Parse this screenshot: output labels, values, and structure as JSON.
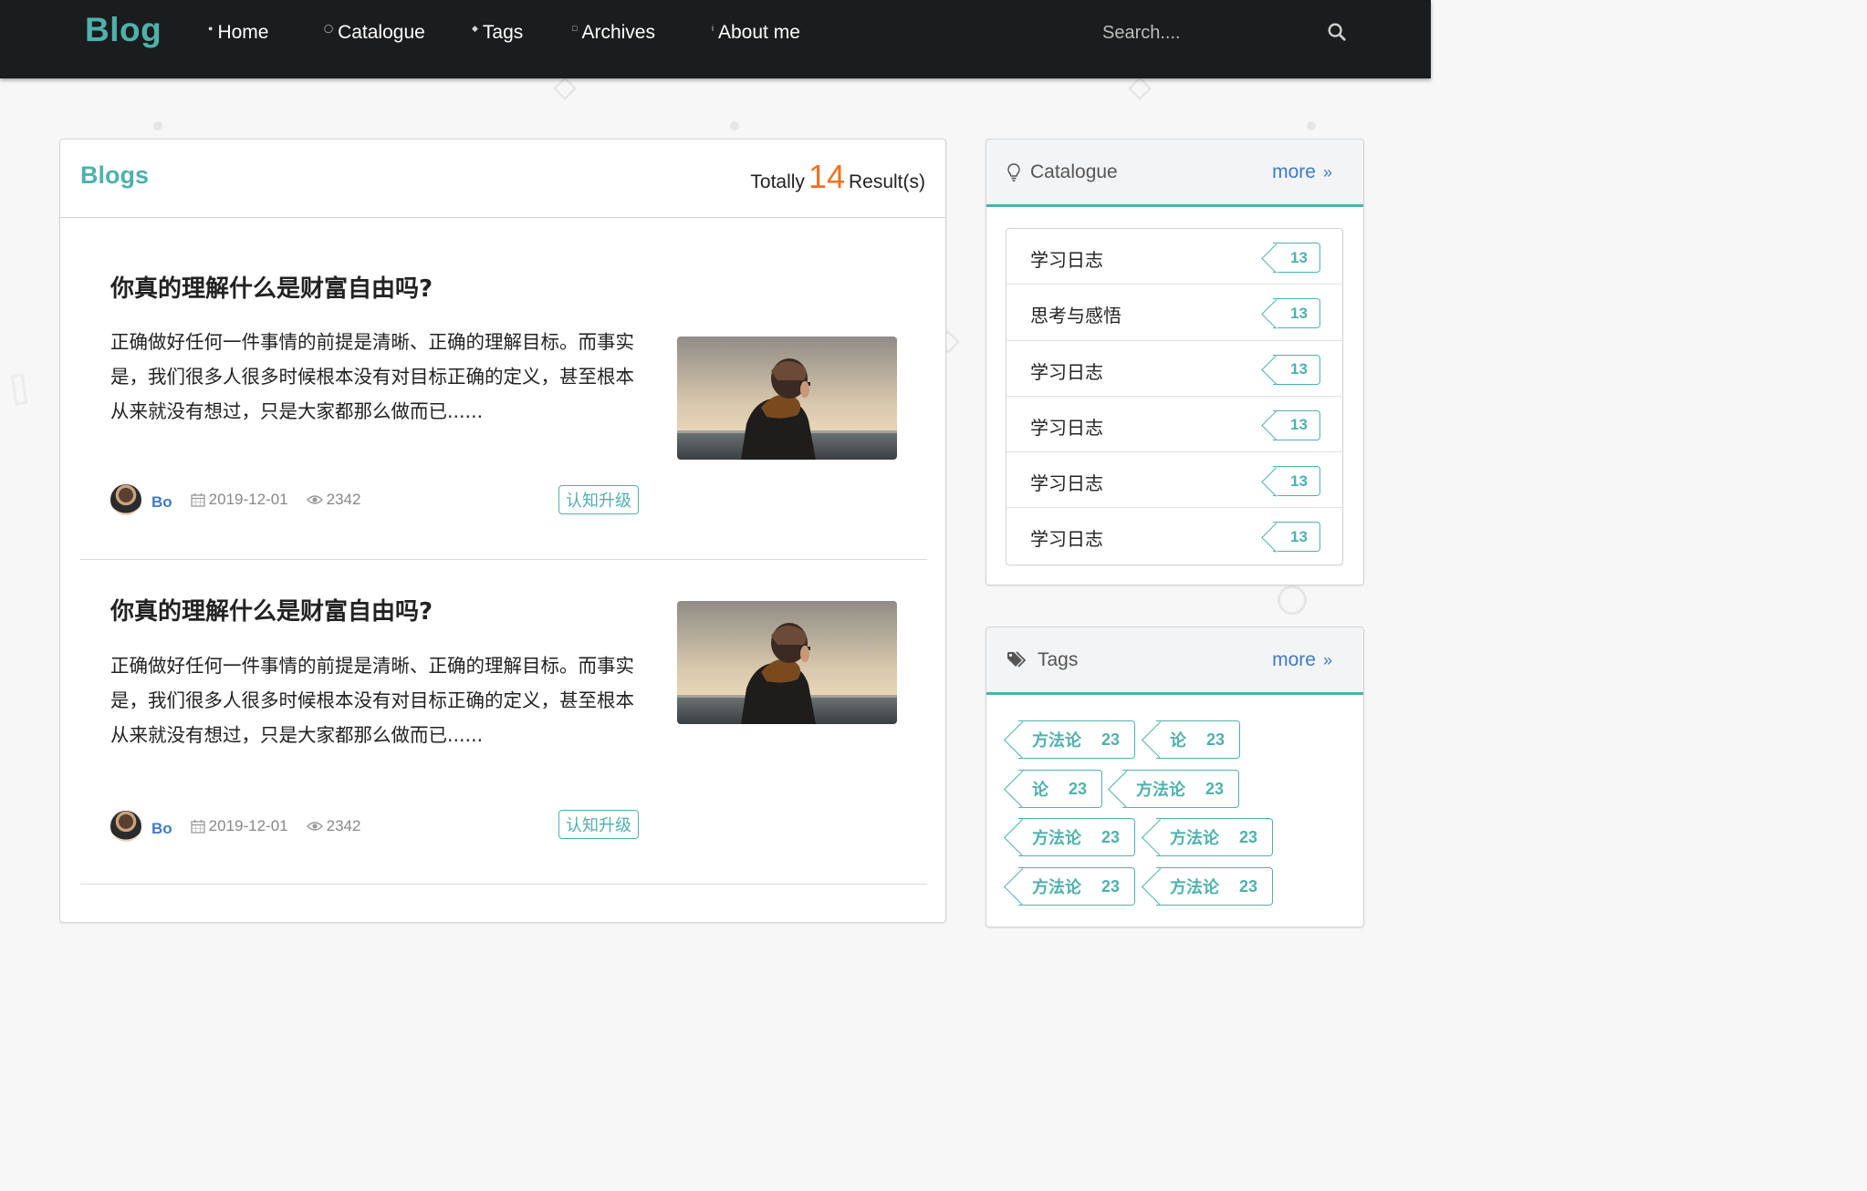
{
  "nav": {
    "brand": "Blog",
    "items": [
      {
        "label": "Home",
        "icon": "home-icon"
      },
      {
        "label": "Catalogue",
        "icon": "idea-icon"
      },
      {
        "label": "Tags",
        "icon": "tag-icon"
      },
      {
        "label": "Archives",
        "icon": "clone-icon"
      },
      {
        "label": "About me",
        "icon": "info-icon"
      }
    ],
    "search_placeholder": "Search....",
    "search_icon": "search-icon"
  },
  "main": {
    "title": "Blogs",
    "total_prefix": "Totally",
    "total_count": "14",
    "total_suffix": "Result(s)",
    "posts": [
      {
        "title": "你真的理解什么是财富自由吗?",
        "excerpt": "正确做好任何一件事情的前提是清晰、正确的理解目标。而事实是，我们很多人很多时候根本没有对目标正确的定义，甚至根本从来就没有想过，只是大家都那么做而已......",
        "author": "Bo",
        "date": "2019-12-01",
        "views": "2342",
        "tag": "认知升级"
      },
      {
        "title": "你真的理解什么是财富自由吗?",
        "excerpt": "正确做好任何一件事情的前提是清晰、正确的理解目标。而事实是，我们很多人很多时候根本没有对目标正确的定义，甚至根本从来就没有想过，只是大家都那么做而已......",
        "author": "Bo",
        "date": "2019-12-01",
        "views": "2342",
        "tag": "认知升级"
      }
    ]
  },
  "sidebar": {
    "catalogue": {
      "title": "Catalogue",
      "more": "more",
      "items": [
        {
          "name": "学习日志",
          "count": "13"
        },
        {
          "name": "思考与感悟",
          "count": "13"
        },
        {
          "name": "学习日志",
          "count": "13"
        },
        {
          "name": "学习日志",
          "count": "13"
        },
        {
          "name": "学习日志",
          "count": "13"
        },
        {
          "name": "学习日志",
          "count": "13"
        }
      ]
    },
    "tags": {
      "title": "Tags",
      "more": "more",
      "items": [
        {
          "name": "方法论",
          "count": "23"
        },
        {
          "name": "论",
          "count": "23"
        },
        {
          "name": "论",
          "count": "23"
        },
        {
          "name": "方法论",
          "count": "23"
        },
        {
          "name": "方法论",
          "count": "23"
        },
        {
          "name": "方法论",
          "count": "23"
        },
        {
          "name": "方法论",
          "count": "23"
        },
        {
          "name": "方法论",
          "count": "23"
        }
      ]
    }
  },
  "colors": {
    "accent": "#4fb1ac",
    "link": "#3e7bc4",
    "highlight": "#f2711c",
    "navbar": "#1b1c1d"
  }
}
